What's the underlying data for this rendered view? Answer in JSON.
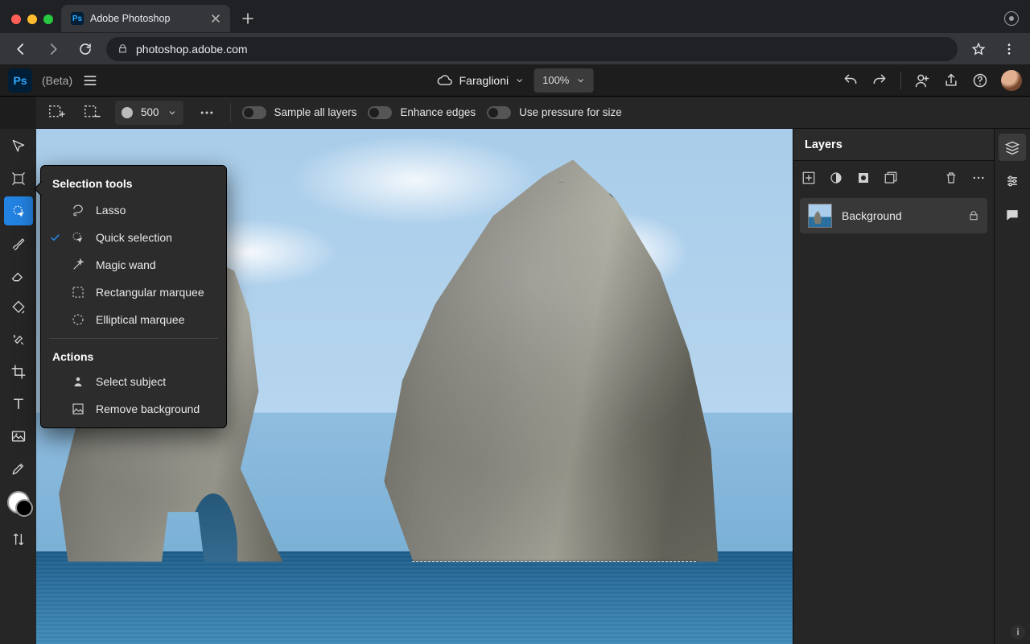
{
  "browser": {
    "tab_title": "Adobe Photoshop",
    "url_domain": "photoshop.adobe.com",
    "url_path": ""
  },
  "app": {
    "logo": "Ps",
    "beta_label": "(Beta)",
    "doc_name": "Faraglioni",
    "zoom": "100%"
  },
  "optionsbar": {
    "brush_size": "500",
    "toggle1": "Sample all layers",
    "toggle2": "Enhance edges",
    "toggle3": "Use pressure for size"
  },
  "flyout": {
    "title": "Selection tools",
    "tools": [
      {
        "label": "Lasso",
        "checked": false
      },
      {
        "label": "Quick selection",
        "checked": true
      },
      {
        "label": "Magic wand",
        "checked": false
      },
      {
        "label": "Rectangular marquee",
        "checked": false
      },
      {
        "label": "Elliptical marquee",
        "checked": false
      }
    ],
    "actions_title": "Actions",
    "actions": [
      {
        "label": "Select subject"
      },
      {
        "label": "Remove background"
      }
    ]
  },
  "panel": {
    "title": "Layers",
    "layer_name": "Background"
  }
}
